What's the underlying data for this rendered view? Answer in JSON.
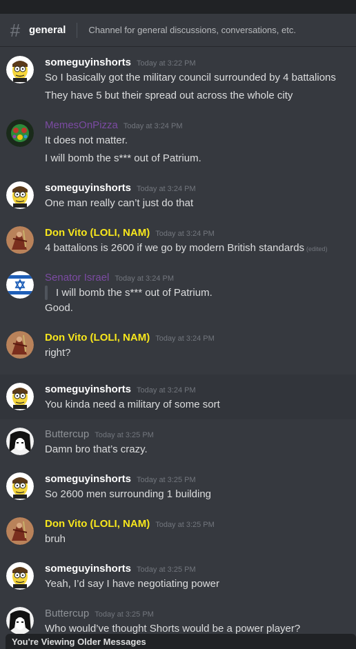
{
  "channel": {
    "name": "general",
    "topic": "Channel for general discussions, conversations, etc."
  },
  "messages": [
    {
      "author": "someguyinshorts",
      "time": "Today at 3:22 PM",
      "lines": [
        "So I basically got the military council surrounded by 4 battalions",
        "They have 5 but their spread out across the whole city"
      ]
    },
    {
      "author": "MemesOnPizza",
      "time": "Today at 3:24 PM",
      "lines": [
        "It does not matter.",
        "I will bomb the s*** out of Patrium."
      ]
    },
    {
      "author": "someguyinshorts",
      "time": "Today at 3:24 PM",
      "lines": [
        "One man really can’t just do that"
      ]
    },
    {
      "author": "Don Vito (LOLI, NAM)",
      "time": "Today at 3:24 PM",
      "lines": [
        "4 battalions is 2600 if we go by modern British standards"
      ],
      "edited": "(edited)"
    },
    {
      "author": "Senator Israel",
      "time": "Today at 3:24 PM",
      "quote": "I will bomb the s*** out of Patrium.",
      "lines": [
        "Good."
      ]
    },
    {
      "author": "Don Vito (LOLI, NAM)",
      "time": "Today at 3:24 PM",
      "lines": [
        "right?"
      ]
    },
    {
      "author": "someguyinshorts",
      "time": "Today at 3:24 PM",
      "lines": [
        "You kinda need a military of some sort"
      ]
    },
    {
      "author": "Buttercup",
      "time": "Today at 3:25 PM",
      "lines": [
        "Damn bro that’s crazy."
      ]
    },
    {
      "author": "someguyinshorts",
      "time": "Today at 3:25 PM",
      "lines": [
        "So 2600 men surrounding 1 building"
      ]
    },
    {
      "author": "Don Vito (LOLI, NAM)",
      "time": "Today at 3:25 PM",
      "lines": [
        "bruh"
      ]
    },
    {
      "author": "someguyinshorts",
      "time": "Today at 3:25 PM",
      "lines": [
        "Yeah, I’d say I have negotiating power"
      ]
    },
    {
      "author": "Buttercup",
      "time": "Today at 3:25 PM",
      "lines": [
        "Who would’ve thought Shorts would be a power player?"
      ]
    }
  ],
  "older_messages_banner": "You're Viewing Older Messages",
  "colors": {
    "background": "#36393f",
    "name_white": "#ffffff",
    "name_purple": "#7c4ba3",
    "name_yellow": "#f8e71c",
    "name_gray": "#8e9297"
  }
}
